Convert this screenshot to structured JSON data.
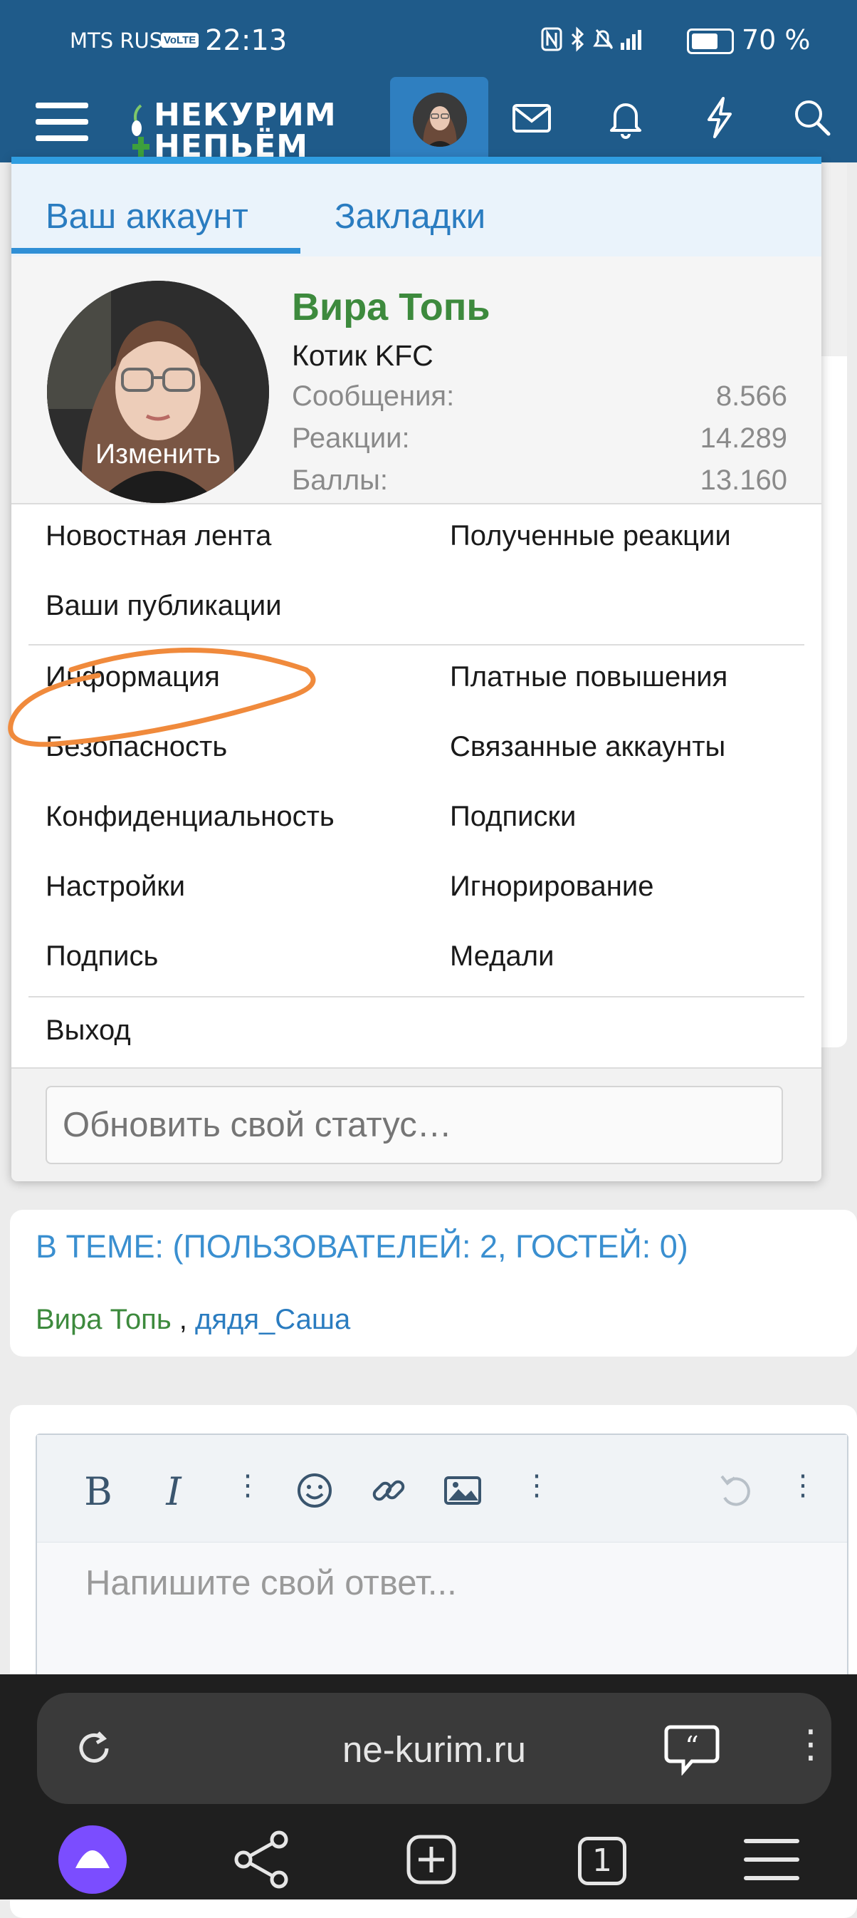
{
  "status_bar": {
    "carrier": "MTS RUS",
    "volte": "VoLTE",
    "time": "22:13",
    "battery_percent": "70 %"
  },
  "header": {
    "logo_line1": "НЕКУРИМ",
    "logo_line2": "НЕПЬЁМ",
    "icons": [
      "menu-icon",
      "avatar",
      "mail-icon",
      "bell-icon",
      "bolt-icon",
      "search-icon"
    ]
  },
  "account_menu": {
    "tabs": [
      "Ваш аккаунт",
      "Закладки"
    ],
    "profile": {
      "name": "Вира Топь",
      "title": "Котик KFC",
      "avatar_edit_label": "Изменить",
      "stats": [
        {
          "label": "Сообщения:",
          "value": "8.566"
        },
        {
          "label": "Реакции:",
          "value": "14.289"
        },
        {
          "label": "Баллы:",
          "value": "13.160"
        }
      ]
    },
    "section1": {
      "left": [
        "Новостная лента",
        "Ваши публикации"
      ],
      "right": [
        "Полученные реакции"
      ]
    },
    "section2": {
      "left": [
        "Информация",
        "Безопасность",
        "Конфиденциальность",
        "Настройки",
        "Подпись"
      ],
      "right": [
        "Платные повышения",
        "Связанные аккаунты",
        "Подписки",
        "Игнорирование",
        "Медали"
      ]
    },
    "logout": "Выход",
    "status_placeholder": "Обновить свой статус…"
  },
  "online": {
    "title": "В ТЕМЕ: (ПОЛЬЗОВАТЕЛЕЙ: 2, ГОСТЕЙ: 0)",
    "user1": "Вира Топь",
    "separator": " , ",
    "user2": "дядя_Саша"
  },
  "editor": {
    "placeholder": "Напишите свой ответ..."
  },
  "browser": {
    "url": "ne-kurim.ru",
    "tab_count": "1"
  },
  "colors": {
    "header_bg": "#1f5b8a",
    "accent": "#2f8fd6",
    "username_green": "#3d8a3d",
    "annotation_orange": "#f08a3c"
  }
}
